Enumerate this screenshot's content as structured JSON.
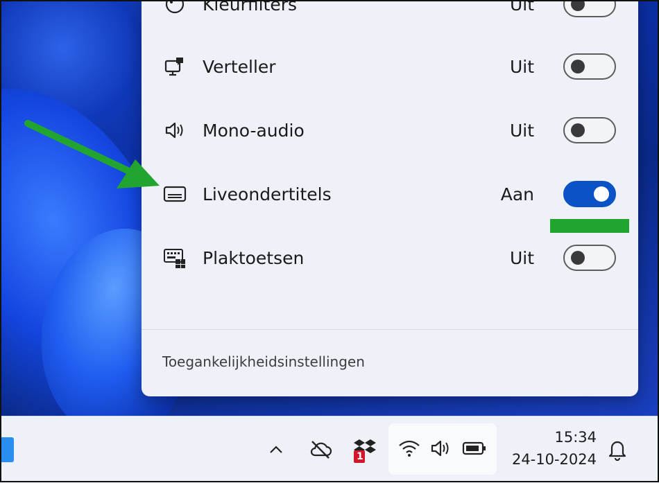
{
  "panel": {
    "rows": [
      {
        "label": "Kleurfilters",
        "state": "Uit",
        "on": false,
        "icon": "color-filter-icon"
      },
      {
        "label": "Verteller",
        "state": "Uit",
        "on": false,
        "icon": "narrator-icon"
      },
      {
        "label": "Mono-audio",
        "state": "Uit",
        "on": false,
        "icon": "speaker-icon"
      },
      {
        "label": "Liveondertitels",
        "state": "Aan",
        "on": true,
        "icon": "captions-icon"
      },
      {
        "label": "Plaktoetsen",
        "state": "Uit",
        "on": false,
        "icon": "sticky-keys-icon"
      }
    ],
    "footer_link": "Toegankelijkheidsinstellingen"
  },
  "taskbar": {
    "time": "15:34",
    "date": "24-10-2024",
    "dropbox_badge": "1",
    "icons": [
      "chevron-up-icon",
      "cloud-off-icon",
      "dropbox-icon",
      "wifi-icon",
      "volume-icon",
      "battery-icon",
      "bell-icon"
    ]
  },
  "colors": {
    "toggle_on": "#0a52c6",
    "annotation": "#22a431"
  }
}
